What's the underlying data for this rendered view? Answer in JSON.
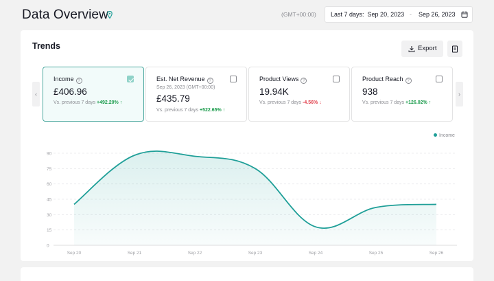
{
  "header": {
    "title": "Data Overview",
    "timezone": "(GMT+00:00)",
    "date_range_label": "Last 7 days:",
    "start_date": "Sep 20, 2023",
    "separator": "-",
    "end_date": "Sep 26, 2023"
  },
  "trends": {
    "title": "Trends",
    "export_label": "Export",
    "prev_arrow": "‹",
    "next_arrow": "›",
    "cards": [
      {
        "title": "Income",
        "value": "£406.96",
        "compare_text": "Vs. previous 7 days",
        "change": "+492.20%",
        "trend_arrow": "↑",
        "checked": true
      },
      {
        "title": "Est. Net Revenue",
        "subtitle": "Sep 26, 2023 (GMT+00:00)",
        "value": "£435.79",
        "compare_text": "Vs. previous 7 days",
        "change": "+522.65%",
        "trend_arrow": "↑",
        "checked": false
      },
      {
        "title": "Product Views",
        "value": "19.94K",
        "compare_text": "Vs. previous 7 days",
        "change": "-4.56%",
        "trend_arrow": "↓",
        "checked": false
      },
      {
        "title": "Product Reach",
        "value": "938",
        "compare_text": "Vs. previous 7 days",
        "change": "+126.02%",
        "trend_arrow": "↑",
        "checked": false
      }
    ],
    "colors": {
      "accent": "#1f9f98",
      "positive": "#1a9b4b",
      "negative": "#e2434f"
    }
  },
  "chart_data": {
    "type": "area",
    "x": [
      "Sep 20",
      "Sep 21",
      "Sep 22",
      "Sep 23",
      "Sep 24",
      "Sep 25",
      "Sep 26"
    ],
    "series": [
      {
        "name": "Income",
        "values": [
          40,
          88,
          87,
          75,
          18,
          37,
          40
        ],
        "color": "#1f9f98"
      }
    ],
    "yticks": [
      0,
      15,
      30,
      45,
      60,
      75,
      90
    ],
    "ylim": [
      0,
      90
    ],
    "grid": true,
    "legend": "top-right"
  }
}
